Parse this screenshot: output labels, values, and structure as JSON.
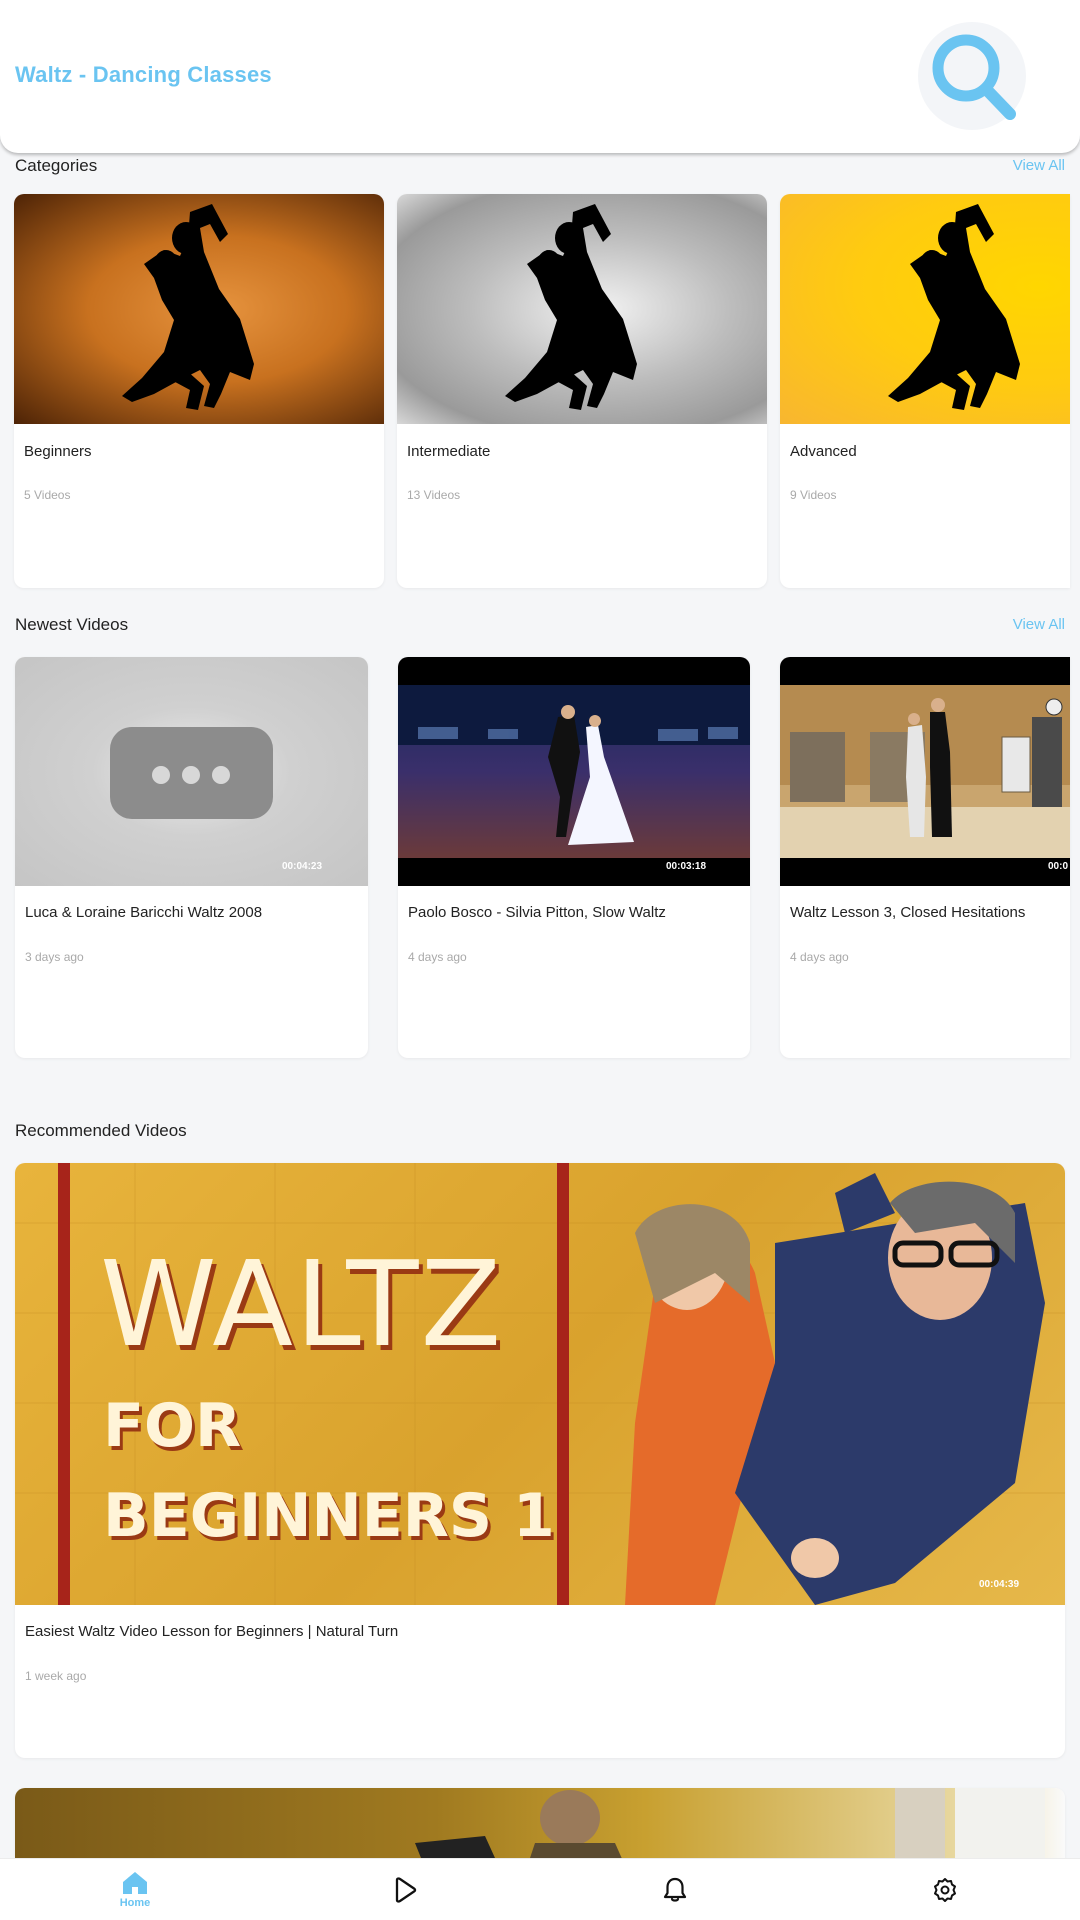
{
  "app": {
    "title": "Waltz - Dancing Classes"
  },
  "colors": {
    "accent": "#6ac4f1",
    "background": "#f5f6f8",
    "card": "#ffffff"
  },
  "categories": {
    "title": "Categories",
    "view_all": "View All",
    "items": [
      {
        "name": "Beginners",
        "count": "5 Videos",
        "theme": "orange"
      },
      {
        "name": "Intermediate",
        "count": "13 Videos",
        "theme": "gray"
      },
      {
        "name": "Advanced",
        "count": "9 Videos",
        "theme": "yellow"
      }
    ]
  },
  "newest": {
    "title": "Newest Videos",
    "view_all": "View All",
    "items": [
      {
        "title": "Luca & Loraine Baricchi Waltz 2008",
        "time": "3 days ago",
        "duration": "00:04:23"
      },
      {
        "title": "Paolo Bosco - Silvia Pitton, Slow Waltz",
        "time": "4 days ago",
        "duration": "00:03:18"
      },
      {
        "title": "Waltz Lesson 3, Closed Hesitations",
        "time": "4 days ago",
        "duration": "00:0"
      }
    ]
  },
  "recommended": {
    "title": "Recommended Videos",
    "items": [
      {
        "thumb_text": [
          "WALTZ",
          "FOR",
          "BEGINNERS 1"
        ],
        "title": "Easiest Waltz Video Lesson for Beginners | Natural Turn",
        "time": "1 week ago",
        "duration": "00:04:39"
      }
    ]
  },
  "nav": {
    "items": [
      {
        "label": "Home",
        "icon": "home-icon",
        "active": true
      },
      {
        "label": "",
        "icon": "play-icon",
        "active": false
      },
      {
        "label": "",
        "icon": "bell-icon",
        "active": false
      },
      {
        "label": "",
        "icon": "gear-icon",
        "active": false
      }
    ]
  }
}
